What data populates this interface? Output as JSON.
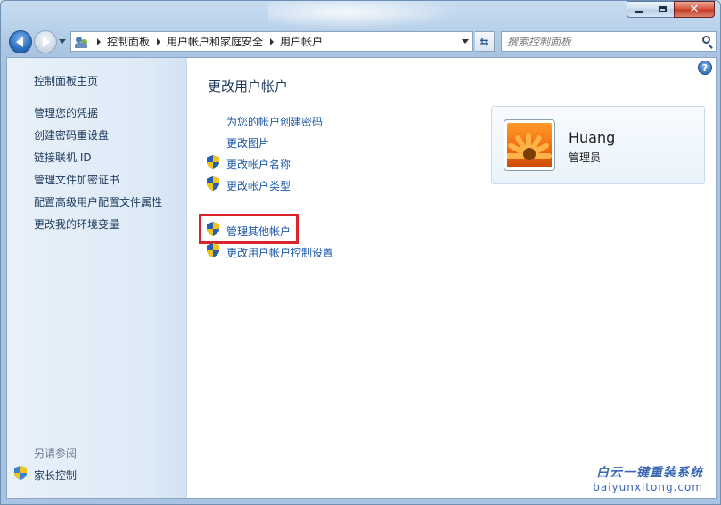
{
  "window": {
    "caption_buttons": {
      "minimize": "minimize-icon",
      "maximize": "maximize-icon",
      "close": "close-icon"
    }
  },
  "navigation": {
    "breadcrumbs": [
      "控制面板",
      "用户帐户和家庭安全",
      "用户帐户"
    ],
    "search_placeholder": "搜索控制面板"
  },
  "sidebar": {
    "home": "控制面板主页",
    "links": [
      "管理您的凭据",
      "创建密码重设盘",
      "链接联机 ID",
      "管理文件加密证书",
      "配置高级用户配置文件属性",
      "更改我的环境变量"
    ],
    "see_also_heading": "另请参阅",
    "see_also_links": [
      "家长控制"
    ]
  },
  "main": {
    "title": "更改用户帐户",
    "tasks": [
      {
        "label": "为您的帐户创建密码",
        "shield": false
      },
      {
        "label": "更改图片",
        "shield": false
      },
      {
        "label": "更改帐户名称",
        "shield": true
      },
      {
        "label": "更改帐户类型",
        "shield": true
      }
    ],
    "tasks2": [
      {
        "label": "管理其他帐户",
        "shield": true,
        "highlighted": true
      },
      {
        "label": "更改用户帐户控制设置",
        "shield": true
      }
    ],
    "help": "?"
  },
  "account": {
    "name": "Huang",
    "role": "管理员"
  },
  "watermark": {
    "text_cn": "白云一键重装系统",
    "text_en": "baiyunxitong.com"
  },
  "colors": {
    "link": "#1d5aa8",
    "highlight_border": "#d8242a",
    "sidebar_bg": "#ddeaf6"
  }
}
